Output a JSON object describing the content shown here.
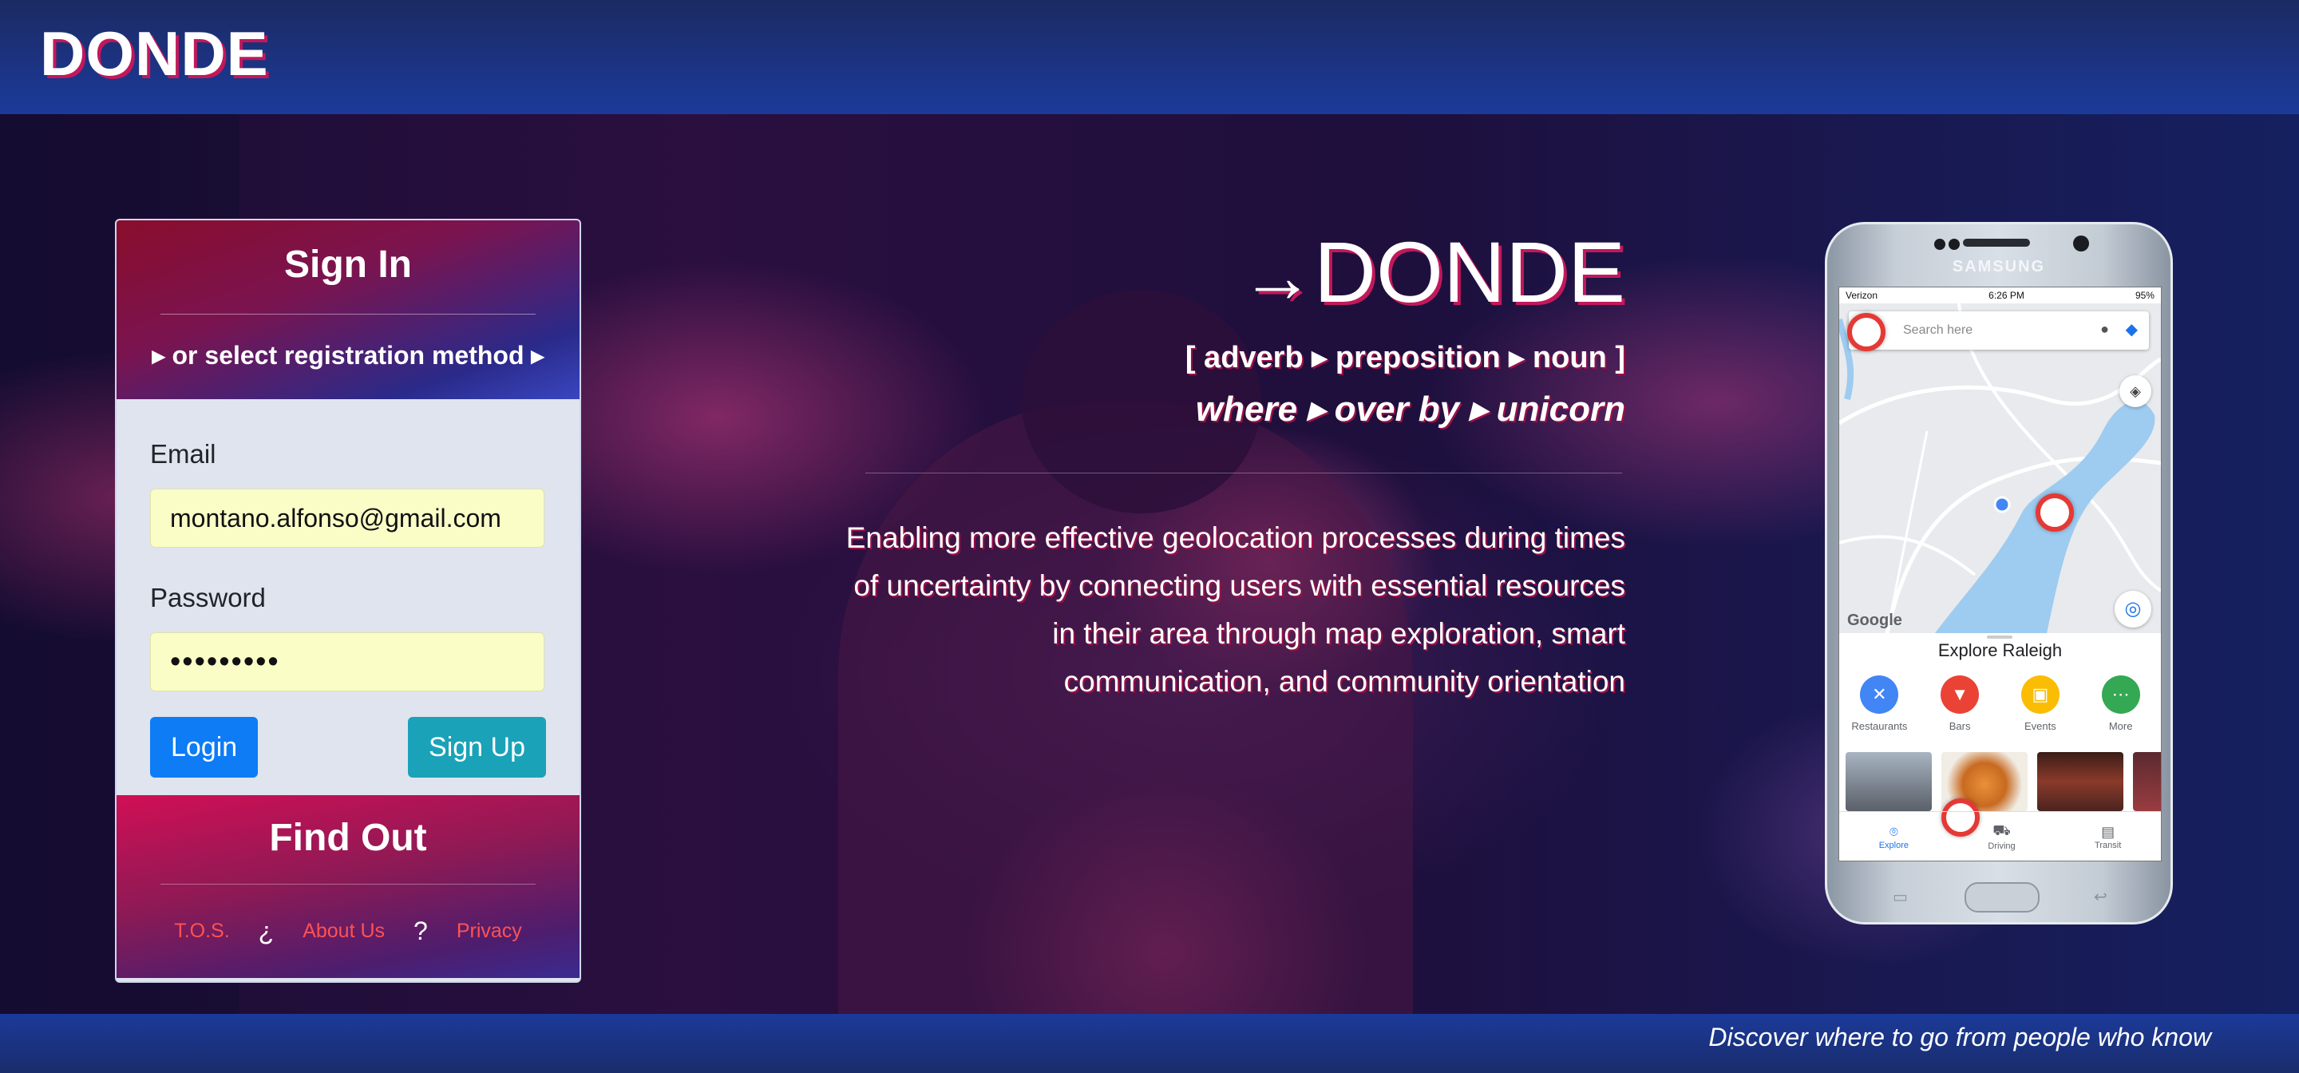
{
  "header": {
    "brand": "DONDE"
  },
  "signin": {
    "title": "Sign In",
    "registration": "▸ or select registration method ▸",
    "email_label": "Email",
    "email_value": "montano.alfonso@gmail.com",
    "password_label": "Password",
    "password_value": "•••••••••",
    "login_label": "Login",
    "signup_label": "Sign Up"
  },
  "findout": {
    "title": "Find Out",
    "links": {
      "tos": "T.O.S.",
      "sep1": "¿",
      "about": "About Us",
      "sep2": "?",
      "privacy": "Privacy"
    }
  },
  "hero": {
    "arrow": "→",
    "title": "DONDE",
    "parts_of_speech": "[ adverb ▸ preposition ▸ noun ]",
    "meanings": "where ▸ over by ▸ unicorn",
    "description": "Enabling more effective geolocation processes during times of uncertainty by connecting users with essential resources in their area through map exploration, smart communication, and community orientation"
  },
  "phone": {
    "brand": "SAMSUNG",
    "status": {
      "carrier": "Verizon",
      "time": "6:26 PM",
      "battery": "95%"
    },
    "search_placeholder": "Search here",
    "map_labels": {
      "google": "Google"
    },
    "explore_title": "Explore Raleigh",
    "categories": [
      {
        "label": "Restaurants",
        "color": "#4285f4",
        "icon": "fork-knife-icon"
      },
      {
        "label": "Bars",
        "color": "#ea4335",
        "icon": "cocktail-icon"
      },
      {
        "label": "Events",
        "color": "#fbbc04",
        "icon": "ticket-icon"
      },
      {
        "label": "More",
        "color": "#34a853",
        "icon": "more-icon"
      }
    ],
    "tabs": [
      {
        "label": "Explore",
        "icon": "pin-icon"
      },
      {
        "label": "Driving",
        "icon": "car-icon"
      },
      {
        "label": "Transit",
        "icon": "bus-icon"
      }
    ]
  },
  "footer": {
    "tagline": "Discover where to go from people who know"
  }
}
